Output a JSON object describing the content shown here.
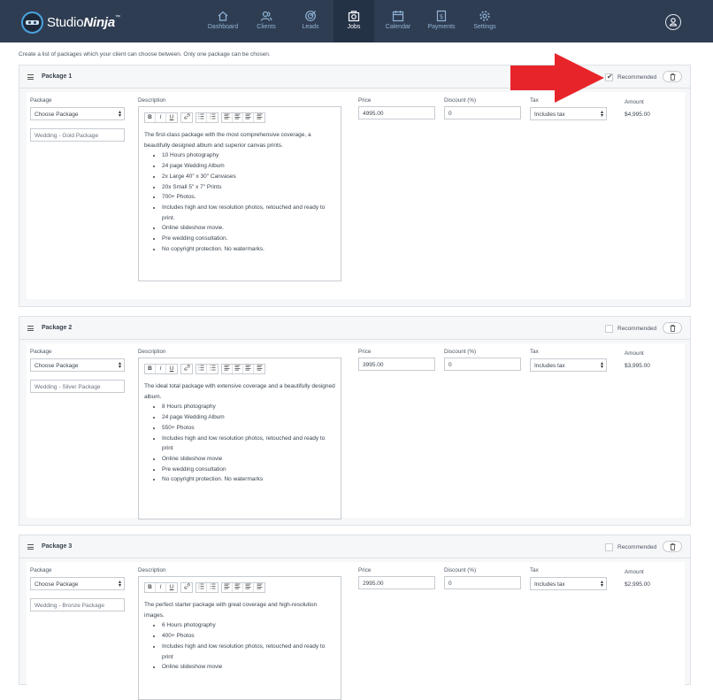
{
  "nav": {
    "brand": "Studio",
    "brand_bold": "Ninja",
    "brand_tm": "™",
    "items": [
      {
        "label": "Dashboard",
        "icon": "home-icon"
      },
      {
        "label": "Clients",
        "icon": "users-icon"
      },
      {
        "label": "Leads",
        "icon": "target-icon"
      },
      {
        "label": "Jobs",
        "icon": "camera-icon"
      },
      {
        "label": "Calendar",
        "icon": "calendar-icon"
      },
      {
        "label": "Payments",
        "icon": "invoice-icon"
      },
      {
        "label": "Settings",
        "icon": "gear-icon"
      }
    ],
    "active_index": 3
  },
  "page": {
    "subtitle": "Create a list of packages which your client can choose between. Only one package can be chosen."
  },
  "labels": {
    "package": "Package",
    "description": "Description",
    "price": "Price",
    "discount": "Discount (%)",
    "tax": "Tax",
    "amount": "Amount",
    "recommended": "Recommended"
  },
  "toolbar": [
    "B",
    "I",
    "U"
  ],
  "packages": [
    {
      "title": "Package 1",
      "recommended": true,
      "select": "Choose Package",
      "name": "Wedding - Gold Package",
      "price": "4995.00",
      "discount": "0",
      "tax": "Includes tax",
      "amount": "$4,995.00",
      "intro": "The first-class package with the most comprehensive coverage, a beautifully designed album and superior canvas prints.",
      "bullets": [
        "10 Hours photography",
        "24 page Wedding Album",
        "2x Large 40\" x 30\" Canvases",
        "20x Small 5\" x 7\" Prints",
        "700+ Photos.",
        "Includes high and low resolution photos, retouched and ready to print.",
        "Online slideshow movie.",
        "Pre wedding consultation.",
        "No copyright protection. No watermarks."
      ]
    },
    {
      "title": "Package 2",
      "recommended": false,
      "select": "Choose Package",
      "name": "Wedding - Silver Package",
      "price": "3995.00",
      "discount": "0",
      "tax": "Includes tax",
      "amount": "$3,995.00",
      "intro": "The ideal total package with extensive coverage and a beautifully designed album.",
      "bullets": [
        "8 Hours photography",
        "24 page Wedding Album",
        "550+ Photos",
        "Includes high and low resolution photos, retouched and ready to print",
        "Online slideshow movie",
        "Pre wedding consultation",
        "No copyright protection. No watermarks"
      ]
    },
    {
      "title": "Package 3",
      "recommended": false,
      "select": "Choose Package",
      "name": "Wedding - Bronze Package",
      "price": "2995.00",
      "discount": "0",
      "tax": "Includes tax",
      "amount": "$2,995.00",
      "intro": "The perfect starter package with great coverage and high-resolution images.",
      "bullets": [
        "6 Hours photography",
        "400+ Photos",
        "Includes high and low resolution photos, retouched and ready to print",
        "Online slideshow movie"
      ]
    }
  ],
  "colors": {
    "nav_bg": "#2f3d52",
    "nav_active": "#243246",
    "nav_text": "#8fb3d6",
    "annotation_arrow": "#e8242b"
  }
}
